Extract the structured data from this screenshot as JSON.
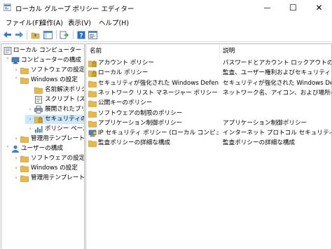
{
  "window": {
    "title": "ローカル グループ ポリシー エディター",
    "minimize_glyph": "—",
    "maximize_glyph": "☐",
    "close_glyph": "✕"
  },
  "menu": {
    "file": "ファイル(F)",
    "action": "操作(A)",
    "view": "表示(V)",
    "help": "ヘルプ(H)"
  },
  "tree": {
    "root": "ローカル コンピューター ポリシー",
    "computer_config": "コンピューターの構成",
    "software_settings": "ソフトウェアの設定",
    "windows_settings": "Windows の設定",
    "name_resolution": "名前解決ポリシー",
    "scripts": "スクリプト (スタートアップ/シャットダウン)",
    "deployed_printers": "展開されたプリンター",
    "security_settings": "セキュリティの設定",
    "qos": "ポリシー ベースの QoS",
    "admin_templates": "管理用テンプレート",
    "user_config": "ユーザーの構成",
    "u_software_settings": "ソフトウェアの設定",
    "u_windows_settings": "Windows の設定",
    "u_admin_templates": "管理用テンプレート"
  },
  "list": {
    "col_name": "名前",
    "col_desc": "説明",
    "rows": [
      {
        "name": "アカウント ポリシー",
        "desc": "パスワードとアカウント ロックアウトのポリシー",
        "icon": "policy-folder-icon"
      },
      {
        "name": "ローカル ポリシー",
        "desc": "監査、ユーザー権利およびセキュリティ オプション ポリシー",
        "icon": "policy-folder-icon"
      },
      {
        "name": "セキュリティが強化された Windows Defender ファイアウォール",
        "desc": "セキュリティが強化された Windows Defender ファイアウォール",
        "icon": "folder-icon"
      },
      {
        "name": "ネットワーク リスト マネージャー ポリシー",
        "desc": "ネットワーク名、アイコン、および場所のグループ ポリシー",
        "icon": "folder-icon"
      },
      {
        "name": "公開キーのポリシー",
        "desc": "",
        "icon": "folder-icon"
      },
      {
        "name": "ソフトウェアの制限のポリシー",
        "desc": "",
        "icon": "folder-icon"
      },
      {
        "name": "アプリケーション制御ポリシー",
        "desc": "アプリケーション制御ポリシー",
        "icon": "folder-icon"
      },
      {
        "name": "IP セキュリティ ポリシー (ローカル コンピューター)",
        "desc": "インターネット プロトコル セキュリティ (IPsec) 管理",
        "icon": "ipsec-icon"
      },
      {
        "name": "監査ポリシーの詳細な構成",
        "desc": "監査ポリシーの詳細な構成",
        "icon": "folder-icon"
      }
    ]
  },
  "colors": {
    "selection": "#cce8ff",
    "folder": "#e8b94a",
    "accent": "#1e6fc1"
  }
}
